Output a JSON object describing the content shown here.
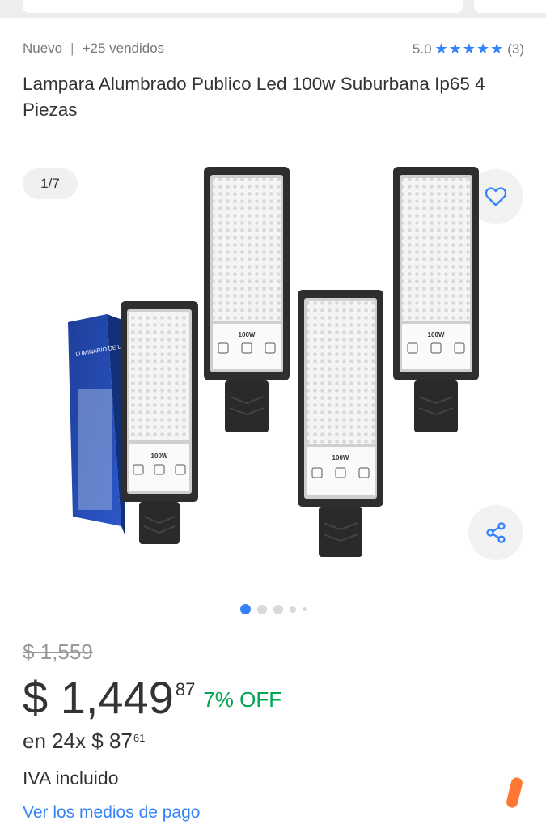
{
  "header": {
    "condition": "Nuevo",
    "separator": "|",
    "sold": "+25 vendidos"
  },
  "rating": {
    "score": "5.0",
    "stars_text": "★★★★★",
    "stars_value": 5,
    "count": "(3)"
  },
  "product": {
    "title": "Lampara Alumbrado Publico Led 100w Suburbana Ip65 4 Piezas"
  },
  "gallery": {
    "counter": "1/7",
    "current_index": 1,
    "total": 7,
    "package_text": "LUMINARIO DE LEDS PARA ALUMBRADO DE VIALIDADES",
    "lamp_label": "100W"
  },
  "icons": {
    "favorite": "heart-icon",
    "share": "share-icon"
  },
  "price": {
    "original": "$ 1,559",
    "current_main": "$ 1,449",
    "current_cents": "87",
    "discount": "7% OFF",
    "installments_prefix": "en 24x $ 87",
    "installments_cents": "61",
    "tax_note": "IVA incluido",
    "payment_link": "Ver los medios de pago"
  },
  "colors": {
    "accent": "#3483fa",
    "discount": "#00a650",
    "text": "#333333",
    "muted": "#999999",
    "mark": "#ff7733"
  }
}
